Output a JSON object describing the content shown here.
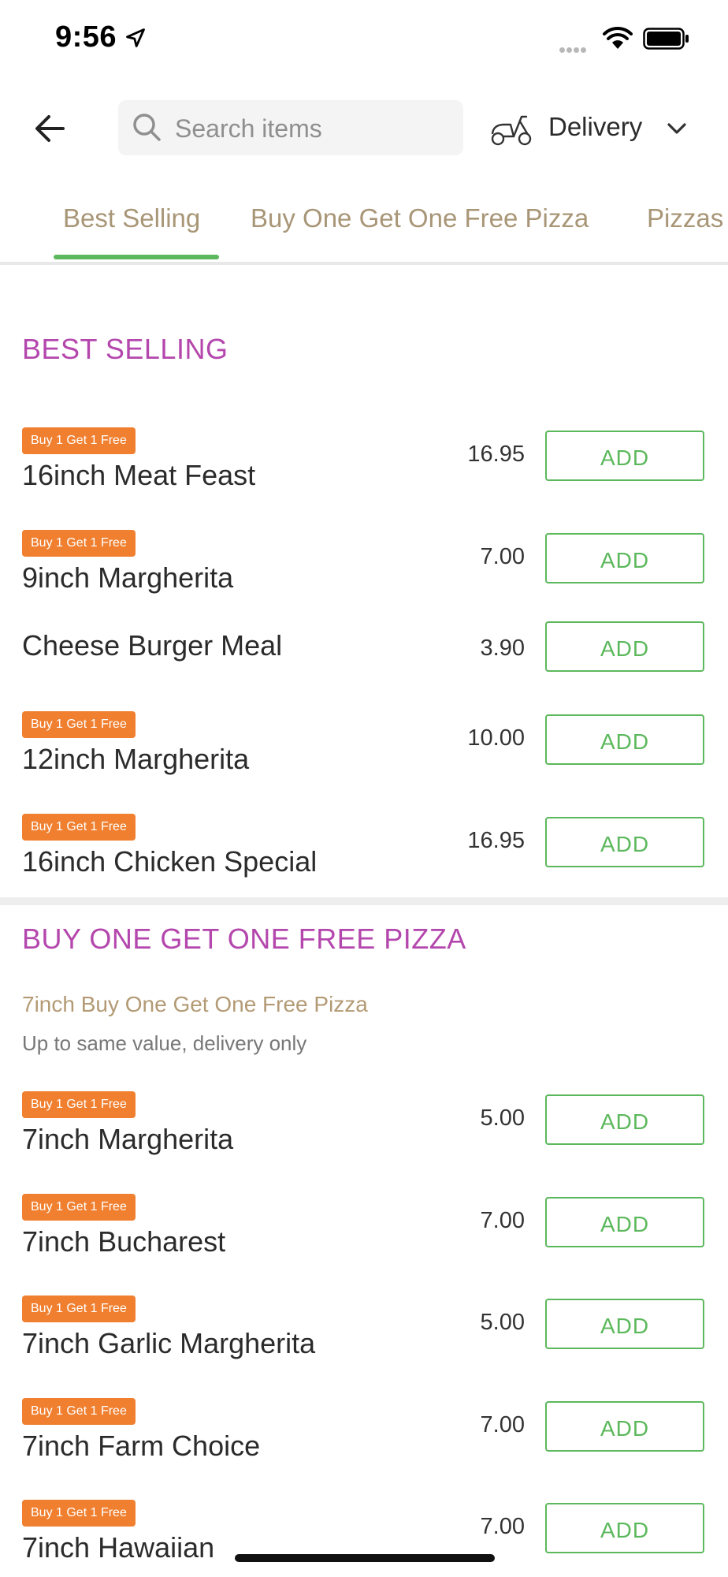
{
  "status_bar": {
    "time": "9:56"
  },
  "header": {
    "search_placeholder": "Search items",
    "delivery_label": "Delivery"
  },
  "tabs": [
    {
      "label": "Best Selling",
      "active": true
    },
    {
      "label": "Buy One Get One Free Pizza",
      "active": false
    },
    {
      "label": "Pizzas",
      "active": false
    }
  ],
  "sections": {
    "best_selling": {
      "title": "BEST SELLING",
      "items": [
        {
          "badge": "Buy 1 Get 1 Free",
          "name": "16inch Meat Feast",
          "price": "16.95",
          "add_label": "ADD"
        },
        {
          "badge": "Buy 1 Get 1 Free",
          "name": "9inch Margherita",
          "price": "7.00",
          "add_label": "ADD"
        },
        {
          "badge": "",
          "name": "Cheese Burger Meal",
          "price": "3.90",
          "add_label": "ADD"
        },
        {
          "badge": "Buy 1 Get 1 Free",
          "name": "12inch Margherita",
          "price": "10.00",
          "add_label": "ADD"
        },
        {
          "badge": "Buy 1 Get 1 Free",
          "name": "16inch Chicken Special",
          "price": "16.95",
          "add_label": "ADD"
        }
      ]
    },
    "bogof": {
      "title": "BUY ONE GET ONE FREE PIZZA",
      "promo_title": "7inch Buy One Get One Free Pizza",
      "promo_subtitle": "Up to same value, delivery only",
      "items": [
        {
          "badge": "Buy 1 Get 1 Free",
          "name": "7inch Margherita",
          "price": "5.00",
          "add_label": "ADD"
        },
        {
          "badge": "Buy 1 Get 1 Free",
          "name": "7inch Bucharest",
          "price": "7.00",
          "add_label": "ADD"
        },
        {
          "badge": "Buy 1 Get 1 Free",
          "name": "7inch Garlic Margherita",
          "price": "5.00",
          "add_label": "ADD"
        },
        {
          "badge": "Buy 1 Get 1 Free",
          "name": "7inch Farm Choice",
          "price": "7.00",
          "add_label": "ADD"
        },
        {
          "badge": "Buy 1 Get 1 Free",
          "name": "7inch Hawaiian",
          "price": "7.00",
          "add_label": "ADD"
        }
      ]
    }
  },
  "colors": {
    "accent_green": "#5cb85c",
    "section_title": "#b447ad",
    "badge_orange": "#f07f2f",
    "tab_text": "#a89677"
  }
}
